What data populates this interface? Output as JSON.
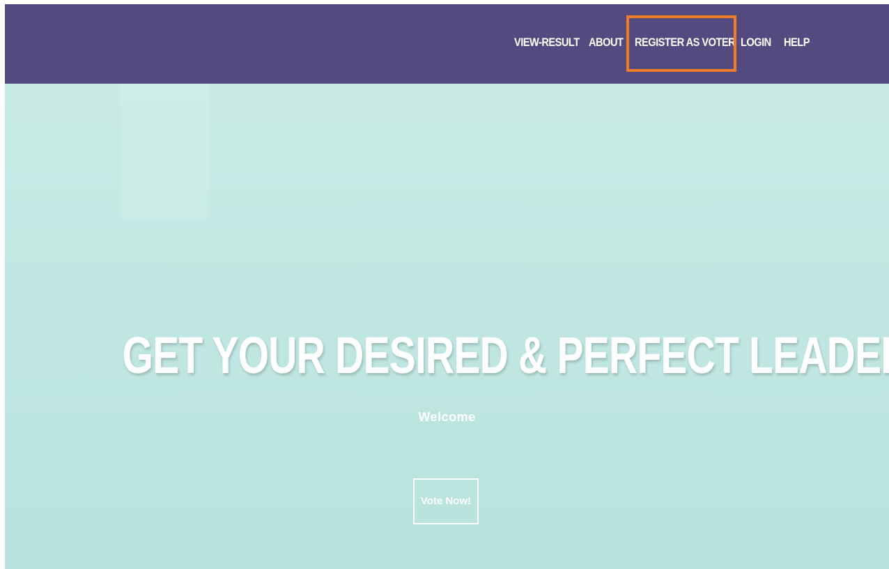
{
  "navbar": {
    "background_color": "#534a80",
    "items": [
      {
        "label": "VIEW-RESULT"
      },
      {
        "label": "ABOUT"
      },
      {
        "label": "REGISTER AS VOTER"
      },
      {
        "label": "LOGIN"
      },
      {
        "label": "HELP"
      }
    ],
    "highlighted_item": "REGISTER AS VOTER",
    "highlight_color": "#f07b28"
  },
  "hero": {
    "background_color": "#c2e7e2",
    "title": "GET YOUR DESIRED & PERFECT LEADER",
    "subtitle": "Welcome",
    "cta_label": "Vote Now!"
  }
}
